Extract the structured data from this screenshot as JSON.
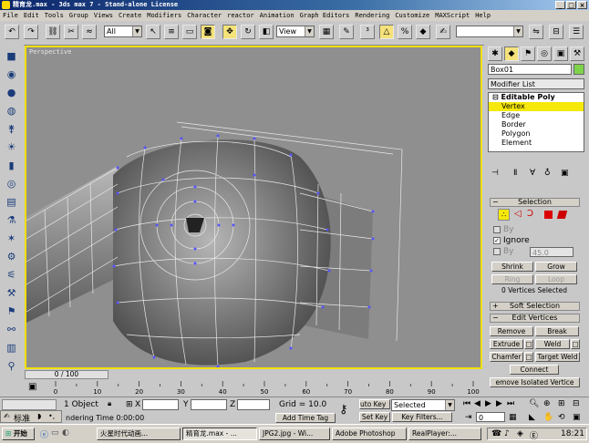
{
  "window": {
    "title": "精育龙.max - 3ds max 7 - Stand-alone License",
    "buttons": [
      "_",
      "□",
      "×"
    ]
  },
  "menu": [
    "File",
    "Edit",
    "Tools",
    "Group",
    "Views",
    "Create",
    "Modifiers",
    "Character",
    "reactor",
    "Animation",
    "Graph Editors",
    "Rendering",
    "Customize",
    "MAXScript",
    "Help"
  ],
  "toolbar": {
    "selection_filter": "All",
    "ref_coord": "View"
  },
  "viewport": {
    "label": "Perspective"
  },
  "panel": {
    "object_name": "Box01",
    "object_color": "#7fd34a",
    "modifier_list": "Modifier List",
    "stack": [
      {
        "label": "Editable Poly",
        "level": 0
      },
      {
        "label": "Vertex",
        "level": 1,
        "selected": true
      },
      {
        "label": "Edge",
        "level": 1
      },
      {
        "label": "Border",
        "level": 1
      },
      {
        "label": "Polygon",
        "level": 1
      },
      {
        "label": "Element",
        "level": 1
      }
    ],
    "selection_rollout": "Selection",
    "by_vertex": "By",
    "ignore": "Ignore",
    "by_angle": "By",
    "angle_value": "45.0",
    "shrink": "Shrink",
    "grow": "Grow",
    "ring": "Ring",
    "loop": "Loop",
    "selected_status": "0 Vertices Selected",
    "soft_selection": "Soft Selection",
    "edit_vertices": "Edit Vertices",
    "remove": "Remove",
    "break": "Break",
    "extrude": "Extrude",
    "weld": "Weld",
    "chamfer": "Chamfer",
    "target_weld": "Target Weld",
    "connect": "Connect",
    "remove_isolated": "emove Isolated Vertice"
  },
  "timeline": {
    "frame_display": "0 / 100",
    "ticks": [
      "0",
      "10",
      "20",
      "30",
      "40",
      "50",
      "60",
      "70",
      "80",
      "90",
      "100"
    ]
  },
  "status": {
    "objects": "1 Object",
    "x_label": "X",
    "y_label": "Y",
    "z_label": "Z",
    "grid": "Grid = 10.0",
    "auto_key": "uto Key",
    "selected": "Selected",
    "set_key": "Set Key",
    "key_filters": "Key Filters...",
    "prompt": "ndering Time  0:00:00",
    "add_time_tag": "Add Time Tag",
    "frame": "0",
    "ime": "标准"
  },
  "taskbar": {
    "start": "开始",
    "tasks": [
      "火星时代动画...",
      "精育龙.max - ...",
      "JPG2.jpg - Wi...",
      "Adobe Photoshop",
      "RealPlayer:..."
    ],
    "clock": "18:21"
  }
}
